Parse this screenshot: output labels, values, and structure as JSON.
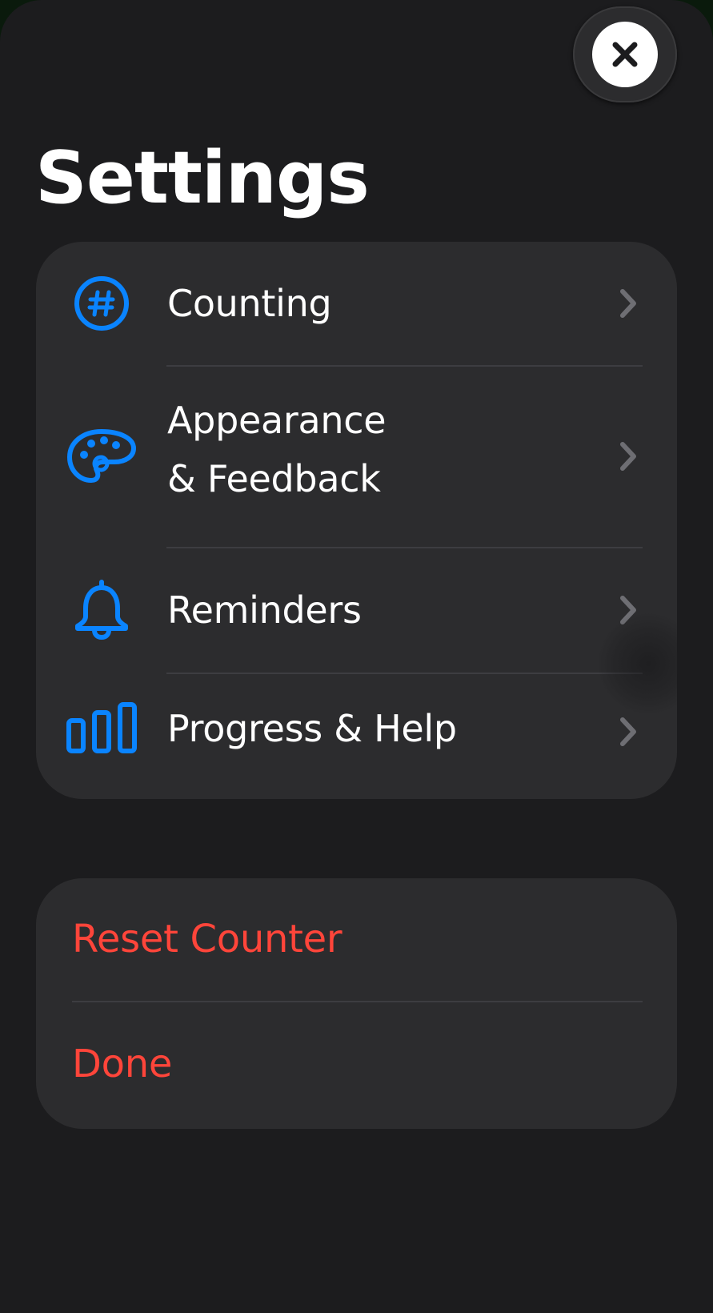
{
  "header": {
    "title": "Settings",
    "close_icon": "xmark-circle-icon"
  },
  "menu": {
    "items": [
      {
        "label": "Counting",
        "icon": "number-circle-icon"
      },
      {
        "label_line1": "Appearance",
        "label_line2": "& Feedback",
        "icon": "palette-icon"
      },
      {
        "label": "Reminders",
        "icon": "bell-icon"
      },
      {
        "label": "Progress & Help",
        "icon": "chart-bars-icon"
      }
    ],
    "chevron_icon": "chevron-right-icon"
  },
  "actions": {
    "reset_label": "Reset Counter",
    "done_label": "Done"
  },
  "colors": {
    "background": "#1c1c1e",
    "group_background": "#2c2c2e",
    "accent_blue": "#0a84ff",
    "destructive_red": "#ff453a",
    "chevron": "#6e6e73"
  }
}
